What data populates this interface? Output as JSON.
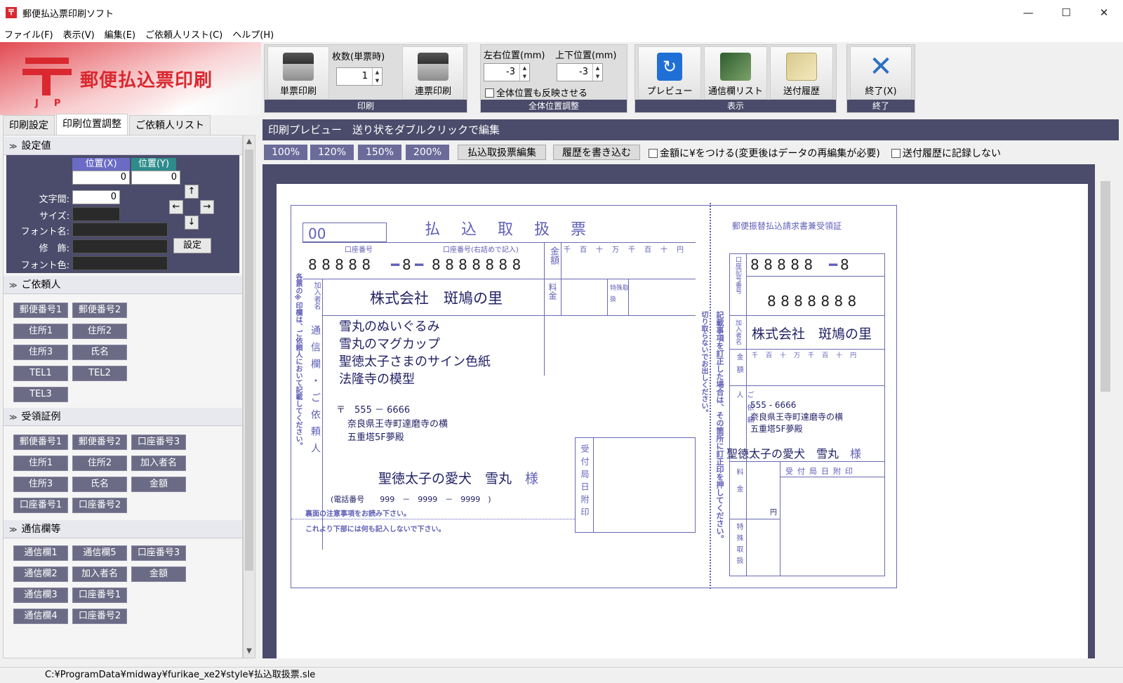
{
  "window": {
    "title": "郵便払込票印刷ソフト",
    "icon": "〒",
    "min": "—",
    "max": "☐",
    "close": "✕"
  },
  "menu": [
    "ファイル(F)",
    "表示(V)",
    "編集(E)",
    "ご依頼人リスト(C)",
    "ヘルプ(H)"
  ],
  "logo": {
    "title": "郵便払込票印刷",
    "jp": "JP"
  },
  "toolbar": {
    "print_group": "印刷",
    "single_print": "単票印刷",
    "copies_label": "枚数(単票時)",
    "copies_value": "1",
    "continuous_print": "連票印刷",
    "position_group": "全体位置調整",
    "lr_label": "左右位置(mm)",
    "lr_value": "-3",
    "ud_label": "上下位置(mm)",
    "ud_value": "-3",
    "reflect_all": "全体位置も反映させる",
    "display_group": "表示",
    "preview": "プレビュー",
    "comm_list": "通信欄リスト",
    "history": "送付履歴",
    "exit_group": "終了",
    "exit": "終了(X)"
  },
  "left": {
    "tabs": [
      "印刷設定",
      "印刷位置調整",
      "ご依頼人リスト"
    ],
    "settings": {
      "header": "設定値",
      "pos_x": "位置(X)",
      "pos_y": "位置(Y)",
      "x_value": "0",
      "y_value": "0",
      "spacing_label": "文字間:",
      "spacing_value": "0",
      "size_label": "サイズ:",
      "font_label": "フォント名:",
      "decor_label": "修　飾:",
      "color_label": "フォント色:",
      "set_button": "設定",
      "arrows": [
        "↑",
        "←",
        "→",
        "↓"
      ]
    },
    "requester": {
      "header": "ご依頼人",
      "buttons": [
        "郵便番号1",
        "郵便番号2",
        "住所1",
        "住所2",
        "住所3",
        "氏名",
        "TEL1",
        "TEL2",
        "TEL3"
      ]
    },
    "receipt": {
      "header": "受領証例",
      "buttons": [
        "郵便番号1",
        "郵便番号2",
        "口座番号3",
        "住所1",
        "住所2",
        "加入者名",
        "住所3",
        "氏名",
        "金額",
        "口座番号1",
        "口座番号2"
      ]
    },
    "comm": {
      "header": "通信欄等",
      "buttons": [
        "通信欄1",
        "通信欄5",
        "口座番号3",
        "通信欄2",
        "加入者名",
        "金額",
        "通信欄3",
        "口座番号1",
        "通信欄4",
        "口座番号2"
      ]
    }
  },
  "right": {
    "preview_header": "印刷プレビュー　送り状をダブルクリックで編集",
    "zoom": [
      "100%",
      "120%",
      "150%",
      "200%"
    ],
    "edit_form": "払込取扱票編集",
    "write_history": "履歴を書き込む",
    "yen_check": "金額に¥をつける(変更後はデータの再編集が必要)",
    "no_history_check": "送付履歴に記録しない"
  },
  "form": {
    "code": "00",
    "title": "払　込　取　扱　票",
    "account_label": "口座番号",
    "account_right_label": "口座番号(右詰めで記入)",
    "amount_label": "金額",
    "units": [
      "千",
      "百",
      "十",
      "万",
      "千",
      "百",
      "十",
      "円"
    ],
    "account_digits_a": "8 8 8 8 8",
    "account_digits_b": "8",
    "account_digits_c": "8 8 8 8 8 8 8",
    "subscriber_label": "加入者名",
    "subscriber": "株式会社　斑鳩の里",
    "fee_label": "料金",
    "special_label": "特殊取扱",
    "comm_label": "通信欄・ご依頼人",
    "comm_lines": [
      "雪丸のぬいぐるみ",
      "雪丸のマグカップ",
      "聖徳太子さまのサイン色紙",
      "法隆寺の模型"
    ],
    "postal_mark": "〒",
    "postal": "555 － 6666",
    "address1": "奈良県王寺町達磨寺の横",
    "address2": "五重塔5F夢殿",
    "name": "聖徳太子の愛犬　雪丸",
    "sama": "様",
    "tel_label": "(電話番号",
    "tel": "999　－　9999　－　9999　)",
    "note1": "裏面の注意事項をお読み下さい。",
    "note2": "これより下部には何も記入しないで下さい。",
    "stamp_label": "受付局日附印",
    "left_vertical": "各票の※印欄は、ご依頼人において記載してください。",
    "mid_vertical1": "切り取らないでお出しください。",
    "mid_vertical2": "記載事項を訂正した場合は、その箇所に訂正印を押してください。",
    "receipt_title": "郵便振替払込請求書兼受領証",
    "receipt_acct_label": "口座記号番号",
    "receipt_digits_top": "8 8 8 8 8",
    "receipt_digits_top2": "8",
    "receipt_digits": "8 8 8 8 8 8 8",
    "receipt_subscriber_label": "加入者名",
    "receipt_subscriber": "株式会社　斑鳩の里",
    "receipt_amount_label": "金額",
    "receipt_units": [
      "千",
      "百",
      "十",
      "万",
      "千",
      "百",
      "十",
      "円"
    ],
    "receipt_requester_label": "ご依頼人",
    "receipt_postal": "555 - 6666",
    "receipt_addr1": "奈良県王寺町達磨寺の横",
    "receipt_addr2": "五重塔5F夢殿",
    "receipt_name": "聖徳太子の愛犬　雪丸",
    "receipt_sama": "様",
    "receipt_fee_label": "料金",
    "receipt_yen": "円",
    "receipt_special_label": "特殊取扱",
    "receipt_stamp_label": "受付局日附印"
  },
  "status": {
    "path": "C:¥ProgramData¥midway¥furikae_xe2¥style¥払込取扱票.sle"
  }
}
